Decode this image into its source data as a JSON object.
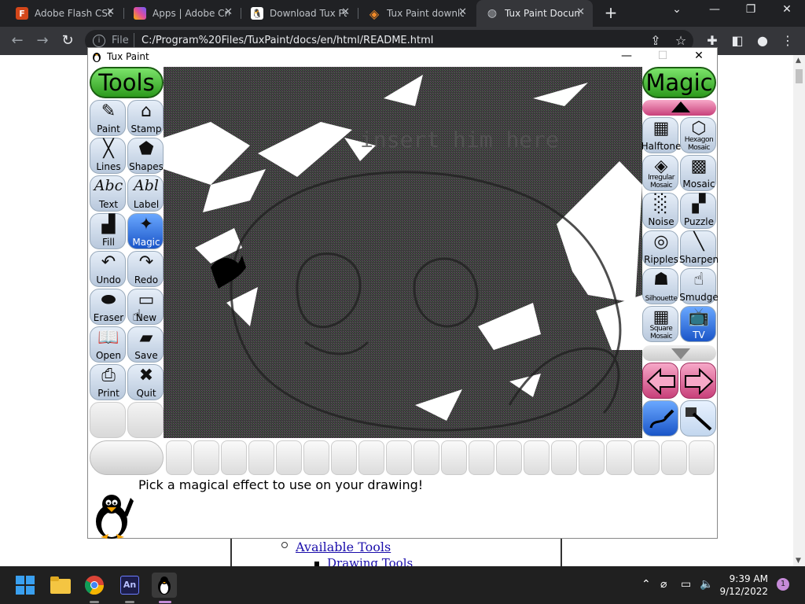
{
  "browser": {
    "tabs": [
      {
        "title": "Adobe Flash CS6",
        "icon": "F",
        "icon_color": "#d4471a"
      },
      {
        "title": "Apps | Adobe Creative",
        "icon": "A",
        "icon_color": "#e24d9b"
      },
      {
        "title": "Download Tux Paint",
        "icon": "T",
        "icon_color": "#222"
      },
      {
        "title": "Tux Paint download",
        "icon": "S",
        "icon_color": "#f28b29"
      },
      {
        "title": "Tux Paint Documentation",
        "icon": "G",
        "icon_color": "#5f6368"
      }
    ],
    "new_tab": "+",
    "url_scheme": "File",
    "url": "C:/Program%20Files/TuxPaint/docs/en/html/README.html"
  },
  "page": {
    "link_available_tools": "Available Tools",
    "link_drawing_tools": "Drawing Tools"
  },
  "tuxpaint": {
    "window_title": "Tux Paint",
    "tools_header": "Tools",
    "magic_header": "Magic",
    "tools": [
      {
        "label": "Paint",
        "glyph": "✎"
      },
      {
        "label": "Stamp",
        "glyph": "⌂"
      },
      {
        "label": "Lines",
        "glyph": "╳"
      },
      {
        "label": "Shapes",
        "glyph": "⬟"
      },
      {
        "label": "Text",
        "glyph": "Abc"
      },
      {
        "label": "Label",
        "glyph": "Abl"
      },
      {
        "label": "Fill",
        "glyph": "▟"
      },
      {
        "label": "Magic",
        "glyph": "✦"
      },
      {
        "label": "Undo",
        "glyph": "↶"
      },
      {
        "label": "Redo",
        "glyph": "↷"
      },
      {
        "label": "Eraser",
        "glyph": "⬬"
      },
      {
        "label": "New",
        "glyph": "▭"
      },
      {
        "label": "Open",
        "glyph": "📖"
      },
      {
        "label": "Save",
        "glyph": "▰"
      },
      {
        "label": "Print",
        "glyph": "⎙"
      },
      {
        "label": "Quit",
        "glyph": "✖"
      }
    ],
    "magic_tools": [
      {
        "label": "Halftone",
        "glyph": "▦"
      },
      {
        "label": "Hexagon Mosaic",
        "glyph": "⬡"
      },
      {
        "label": "Irregular Mosaic",
        "glyph": "◈"
      },
      {
        "label": "Mosaic",
        "glyph": "▩"
      },
      {
        "label": "Noise",
        "glyph": "░"
      },
      {
        "label": "Puzzle",
        "glyph": "▞"
      },
      {
        "label": "Ripples",
        "glyph": "◎"
      },
      {
        "label": "Sharpen",
        "glyph": "╲"
      },
      {
        "label": "Silhouette",
        "glyph": "☗"
      },
      {
        "label": "Smudge",
        "glyph": "☝"
      },
      {
        "label": "Square Mosaic",
        "glyph": "▦"
      },
      {
        "label": "TV",
        "glyph": "📺"
      }
    ],
    "canvas_text": "insert  him  here",
    "instruction": "Pick a magical effect to use on your drawing!"
  },
  "taskbar": {
    "time": "9:39 AM",
    "date": "9/12/2022",
    "notifications": "1"
  }
}
